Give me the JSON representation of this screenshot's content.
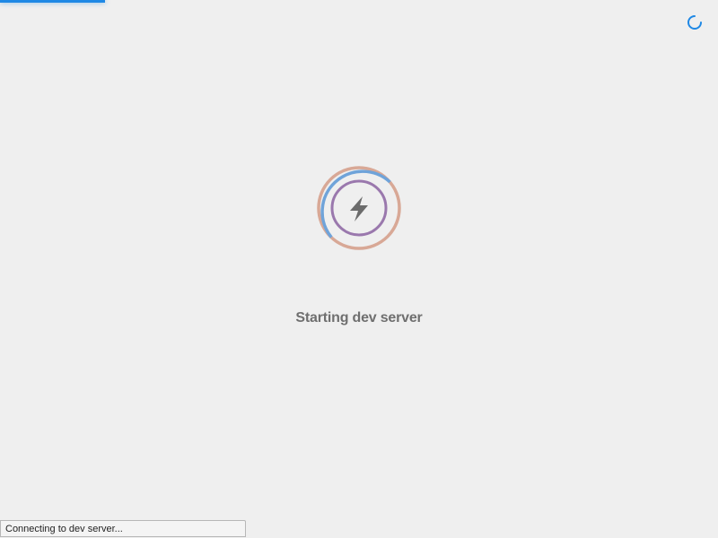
{
  "progress": {
    "fraction": 0.146,
    "color": "#1e88e5"
  },
  "corner_spinner": {
    "icon": "loading-spinner-icon",
    "color": "#1e88e5"
  },
  "loader": {
    "icon": "lightning-bolt-icon",
    "outer_ring_colors": [
      "#6fa3d9",
      "#d8a896"
    ],
    "inner_ring_color": "#9a78ad",
    "bolt_color": "#6b6b6b"
  },
  "status": {
    "title": "Starting dev server"
  },
  "status_bar": {
    "text": "Connecting to dev server..."
  }
}
